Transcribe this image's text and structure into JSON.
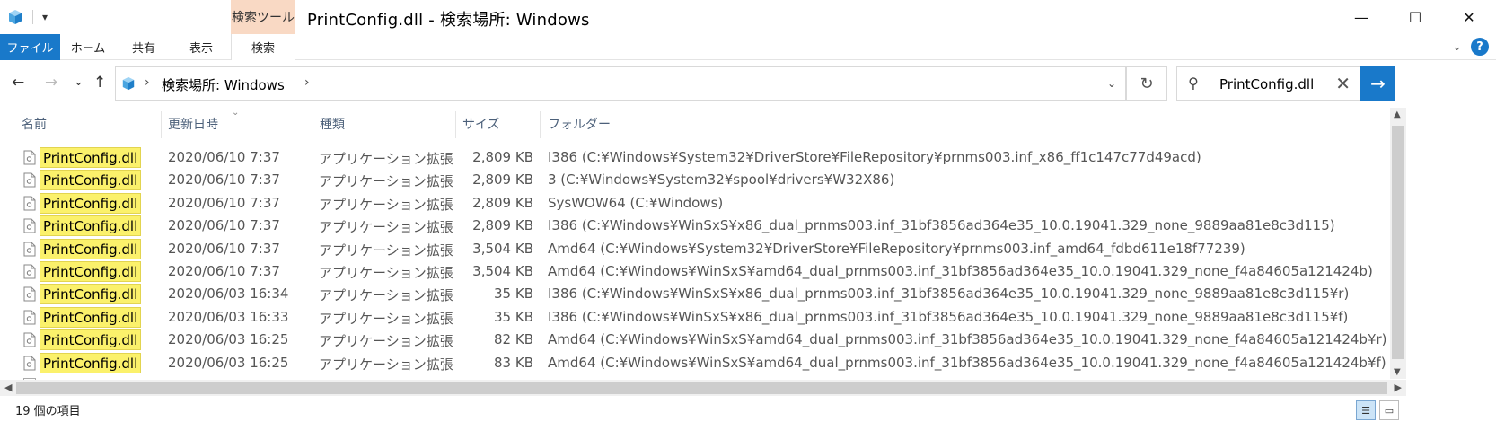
{
  "window": {
    "title": "PrintConfig.dll - 検索場所: Windows",
    "context_tab_group": "検索ツール",
    "controls": {
      "minimize": "—",
      "maximize": "☐",
      "close": "✕"
    }
  },
  "ribbon": {
    "tabs": [
      "ファイル",
      "ホーム",
      "共有",
      "表示",
      "検索"
    ],
    "help_label": "?"
  },
  "navigation": {
    "back_icon": "←",
    "forward_icon": "→",
    "recent_icon": "⌄",
    "up_icon": "↑",
    "address_path": "検索場所: Windows",
    "separator": "›",
    "refresh_icon": "↻"
  },
  "search": {
    "value": "PrintConfig.dll",
    "clear_icon": "✕",
    "go_icon": "→"
  },
  "columns": {
    "name": "名前",
    "modified": "更新日時",
    "type": "種類",
    "size": "サイズ",
    "folder": "フォルダー"
  },
  "files": [
    {
      "name": "PrintConfig.dll",
      "date": "2020/06/10 7:37",
      "type": "アプリケーション拡張",
      "size": "2,809 KB",
      "folder": "I386 (C:¥Windows¥System32¥DriverStore¥FileRepository¥prnms003.inf_x86_ff1c147c77d49acd)"
    },
    {
      "name": "PrintConfig.dll",
      "date": "2020/06/10 7:37",
      "type": "アプリケーション拡張",
      "size": "2,809 KB",
      "folder": "3 (C:¥Windows¥System32¥spool¥drivers¥W32X86)"
    },
    {
      "name": "PrintConfig.dll",
      "date": "2020/06/10 7:37",
      "type": "アプリケーション拡張",
      "size": "2,809 KB",
      "folder": "SysWOW64 (C:¥Windows)"
    },
    {
      "name": "PrintConfig.dll",
      "date": "2020/06/10 7:37",
      "type": "アプリケーション拡張",
      "size": "2,809 KB",
      "folder": "I386 (C:¥Windows¥WinSxS¥x86_dual_prnms003.inf_31bf3856ad364e35_10.0.19041.329_none_9889aa81e8c3d115)"
    },
    {
      "name": "PrintConfig.dll",
      "date": "2020/06/10 7:37",
      "type": "アプリケーション拡張",
      "size": "3,504 KB",
      "folder": "Amd64 (C:¥Windows¥System32¥DriverStore¥FileRepository¥prnms003.inf_amd64_fdbd611e18f77239)"
    },
    {
      "name": "PrintConfig.dll",
      "date": "2020/06/10 7:37",
      "type": "アプリケーション拡張",
      "size": "3,504 KB",
      "folder": "Amd64 (C:¥Windows¥WinSxS¥amd64_dual_prnms003.inf_31bf3856ad364e35_10.0.19041.329_none_f4a84605a121424b)"
    },
    {
      "name": "PrintConfig.dll",
      "date": "2020/06/03 16:34",
      "type": "アプリケーション拡張",
      "size": "35 KB",
      "folder": "I386 (C:¥Windows¥WinSxS¥x86_dual_prnms003.inf_31bf3856ad364e35_10.0.19041.329_none_9889aa81e8c3d115¥r)"
    },
    {
      "name": "PrintConfig.dll",
      "date": "2020/06/03 16:33",
      "type": "アプリケーション拡張",
      "size": "35 KB",
      "folder": "I386 (C:¥Windows¥WinSxS¥x86_dual_prnms003.inf_31bf3856ad364e35_10.0.19041.329_none_9889aa81e8c3d115¥f)"
    },
    {
      "name": "PrintConfig.dll",
      "date": "2020/06/03 16:25",
      "type": "アプリケーション拡張",
      "size": "82 KB",
      "folder": "Amd64 (C:¥Windows¥WinSxS¥amd64_dual_prnms003.inf_31bf3856ad364e35_10.0.19041.329_none_f4a84605a121424b¥r)"
    },
    {
      "name": "PrintConfig.dll",
      "date": "2020/06/03 16:25",
      "type": "アプリケーション拡張",
      "size": "83 KB",
      "folder": "Amd64 (C:¥Windows¥WinSxS¥amd64_dual_prnms003.inf_31bf3856ad364e35_10.0.19041.329_none_f4a84605a121424b¥f)"
    }
  ],
  "status": {
    "item_count": "19 個の項目"
  },
  "colors": {
    "accent": "#1979ca",
    "context_tab": "#f9d9c4",
    "highlight": "#fbf16b"
  }
}
